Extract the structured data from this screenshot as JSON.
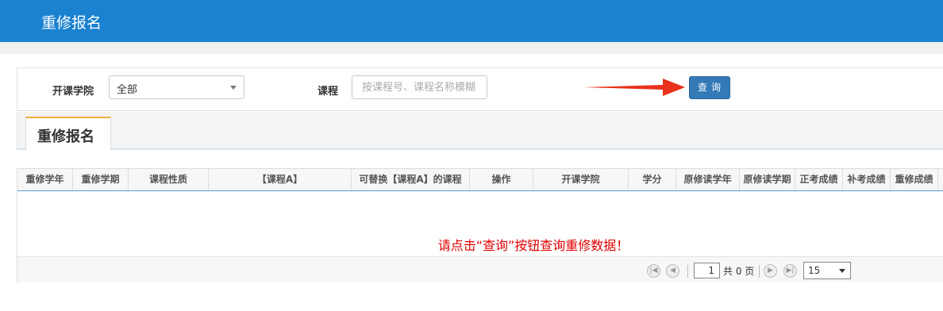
{
  "header": {
    "title": "重修报名"
  },
  "search": {
    "college_label": "开课学院",
    "college_value": "全部",
    "course_label": "课程",
    "course_placeholder": "按课程号、课程名称模糊",
    "query_button": "查询"
  },
  "tab": {
    "label": "重修报名"
  },
  "table": {
    "columns": [
      "重修学年",
      "重修学期",
      "课程性质",
      "【课程A】",
      "可替换【课程A】的课程",
      "操作",
      "开课学院",
      "学分",
      "原修读学年",
      "原修读学期",
      "正考成绩",
      "补考成绩",
      "重修成绩"
    ],
    "empty_message": "请点击“查询”按钮查询重修数据！"
  },
  "pager": {
    "current_page": "1",
    "total_text": "共 0 页",
    "page_size": "15"
  },
  "colors": {
    "header_bg": "#1a82d0",
    "button_bg": "#337ab7",
    "message": "#e00000",
    "arrow": "#e8311c"
  }
}
